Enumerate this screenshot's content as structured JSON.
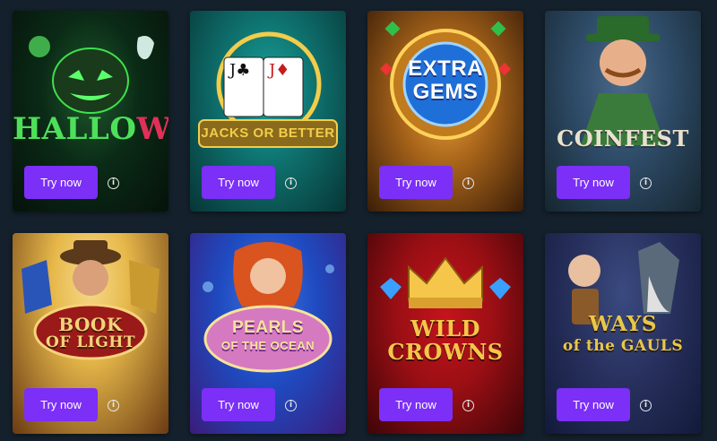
{
  "cta_label": "Try now",
  "info_glyph": "i",
  "accent_color": "#7b2ff7",
  "games": [
    {
      "title_line1": "HALLO",
      "title_line2": "WIN",
      "colors": {
        "bg1": "#0d1a10",
        "bg2": "#0a2a16",
        "title": "#4ee05a",
        "title2": "#e0305a"
      }
    },
    {
      "title_line1": "JACKS OR BETTER",
      "colors": {
        "bg1": "#0e6f6c",
        "bg2": "#0a3a3c",
        "title": "#f2cd4a"
      }
    },
    {
      "title_line1": "EXTRA",
      "title_line2": "GEMS",
      "colors": {
        "bg1": "#a9651a",
        "bg2": "#3a1d08",
        "title": "#ffffff"
      }
    },
    {
      "title_line1": "COINFEST",
      "colors": {
        "bg1": "#2d4a66",
        "bg2": "#16262f",
        "title": "#e8e2d0"
      }
    },
    {
      "title_line1": "BOOK",
      "title_line2": "OF LIGHT",
      "colors": {
        "bg1": "#e6b84a",
        "bg2": "#6a3a12",
        "title": "#f5d37a"
      }
    },
    {
      "title_line1": "PEARLS",
      "title_line2": "OF THE OCEAN",
      "colors": {
        "bg1": "#1f4ac0",
        "bg2": "#3a1c7a",
        "title": "#f6e39a"
      }
    },
    {
      "title_line1": "WILD",
      "title_line2": "CROWNS",
      "colors": {
        "bg1": "#9a0f14",
        "bg2": "#3d0508",
        "title": "#f5c64a"
      }
    },
    {
      "title_line1": "WAYS",
      "title_line2": "of the GAULS",
      "colors": {
        "bg1": "#28315e",
        "bg2": "#121a3a",
        "title": "#e8c74a"
      }
    }
  ]
}
